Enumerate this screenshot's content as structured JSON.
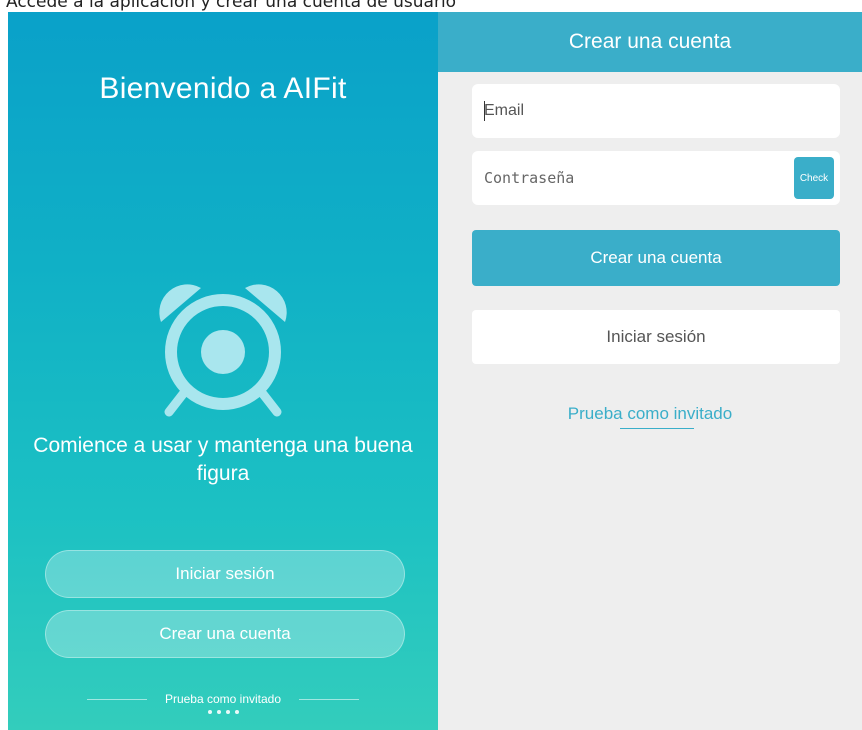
{
  "top_caption": "Accede a la aplicación y crear una cuenta de usuario",
  "welcome_screen": {
    "title": "Bienvenido a AIFit",
    "tagline": "Comience a usar y mantenga una buena\nfigura",
    "login_button": "Iniciar sesión",
    "create_account_button": "Crear una cuenta",
    "guest_link": "Prueba como invitado",
    "icon": "alarm-clock-icon",
    "page_indicator": {
      "total": 4,
      "active": 0
    }
  },
  "create_account_screen": {
    "header_title": "Crear una cuenta",
    "email_placeholder": "Email",
    "password_placeholder": "Contraseña",
    "check_button": "Check",
    "create_account_button": "Crear una cuenta",
    "login_button": "Iniciar sesión",
    "guest_link": "Prueba como invitado"
  },
  "colors": {
    "accent": "#3aaec9",
    "gradient_top": "#0aa1c9",
    "gradient_bottom": "#33cdbc",
    "background": "#eeeeee"
  }
}
